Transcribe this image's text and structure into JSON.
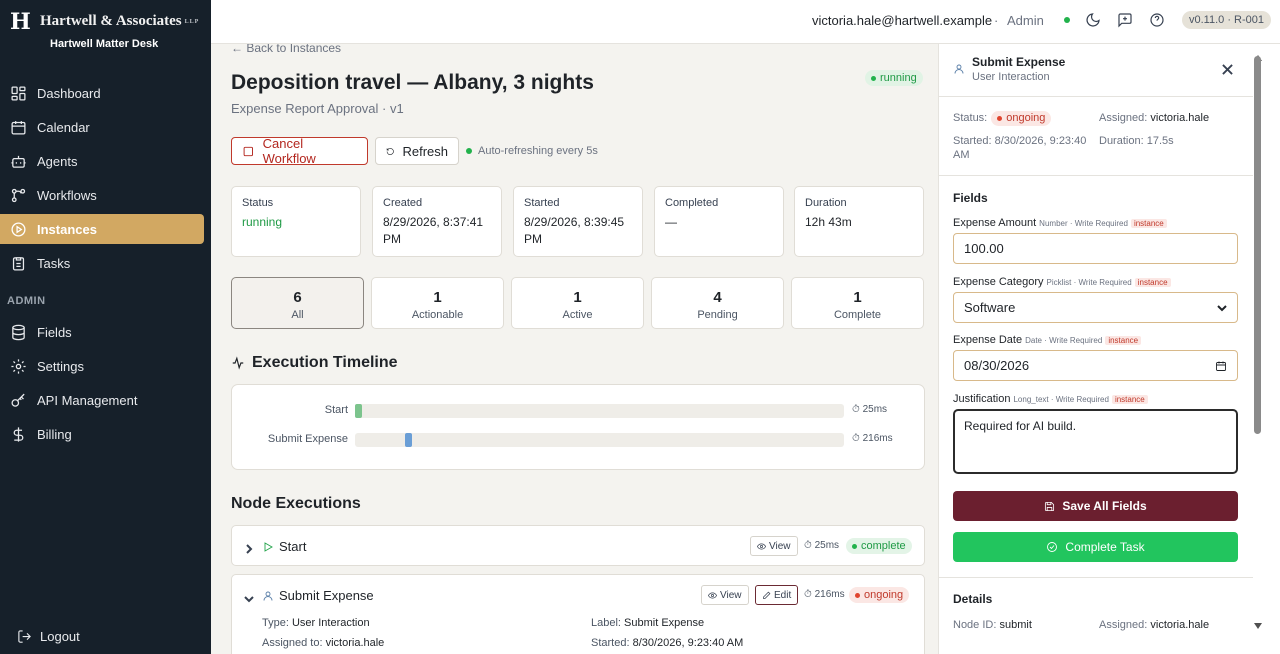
{
  "brand": {
    "logo_letter": "H",
    "firm_name": "Hartwell & Associates",
    "firm_suffix": "LLP",
    "desk_name": "Hartwell Matter Desk"
  },
  "sidebar": {
    "items": [
      {
        "label": "Dashboard",
        "icon": "dashboard-icon"
      },
      {
        "label": "Calendar",
        "icon": "calendar-icon"
      },
      {
        "label": "Agents",
        "icon": "bot-icon"
      },
      {
        "label": "Workflows",
        "icon": "workflow-icon"
      },
      {
        "label": "Instances",
        "icon": "play-icon",
        "active": true
      },
      {
        "label": "Tasks",
        "icon": "clipboard-icon"
      }
    ],
    "admin_heading": "ADMIN",
    "admin_items": [
      {
        "label": "Fields",
        "icon": "database-icon"
      },
      {
        "label": "Settings",
        "icon": "gear-icon"
      },
      {
        "label": "API Management",
        "icon": "key-icon"
      },
      {
        "label": "Billing",
        "icon": "dollar-icon"
      }
    ],
    "logout_label": "Logout"
  },
  "topbar": {
    "user_email": "victoria.hale@hartwell.example",
    "separator": "·",
    "role": "Admin",
    "version": "v0.11.0 · R-001"
  },
  "main": {
    "back_label": "← Back to Instances",
    "title": "Deposition travel — Albany, 3 nights",
    "subtitle": "Expense Report Approval · v1",
    "status_badge": "running",
    "cancel_label": "Cancel Workflow",
    "refresh_label": "Refresh",
    "auto_refresh": "Auto-refreshing every 5s",
    "stats": [
      {
        "label": "Status",
        "value": "running"
      },
      {
        "label": "Created",
        "value": "8/29/2026, 8:37:41 PM"
      },
      {
        "label": "Started",
        "value": "8/29/2026, 8:39:45 PM"
      },
      {
        "label": "Completed",
        "value": "—"
      },
      {
        "label": "Duration",
        "value": "12h 43m"
      }
    ],
    "counts": [
      {
        "num": "6",
        "label": "All"
      },
      {
        "num": "1",
        "label": "Actionable"
      },
      {
        "num": "1",
        "label": "Active"
      },
      {
        "num": "4",
        "label": "Pending"
      },
      {
        "num": "1",
        "label": "Complete"
      }
    ],
    "timeline_heading": "Execution Timeline",
    "timeline": [
      {
        "label": "Start",
        "duration": "25ms",
        "duration_ms": 25,
        "color": "#7cc48d"
      },
      {
        "label": "Submit Expense",
        "duration": "216ms",
        "duration_ms": 216,
        "color": "#6a9ed6"
      }
    ],
    "node_heading": "Node Executions",
    "nodes": [
      {
        "name": "Start",
        "view": "View",
        "duration": "25ms",
        "status": "complete"
      },
      {
        "name": "Submit Expense",
        "view": "View",
        "edit": "Edit",
        "duration": "216ms",
        "status": "ongoing",
        "type_label": "Type:",
        "type_value": "User Interaction",
        "label_label": "Label:",
        "label_value": "Submit Expense",
        "assigned_label": "Assigned to:",
        "assigned_value": "victoria.hale",
        "started_label": "Started:",
        "started_value": "8/30/2026, 9:23:40 AM"
      }
    ]
  },
  "panel": {
    "title": "Submit Expense",
    "subtitle": "User Interaction",
    "status_label": "Status:",
    "status_value": "ongoing",
    "assigned_label": "Assigned:",
    "assigned_value": "victoria.hale",
    "started_label": "Started:",
    "started_value": "8/30/2026, 9:23:40 AM",
    "duration_label": "Duration:",
    "duration_value": "17.5s",
    "fields_heading": "Fields",
    "fields": [
      {
        "label": "Expense Amount",
        "meta": "Number · Write Required",
        "tag": "instance",
        "value": "100.00"
      },
      {
        "label": "Expense Category",
        "meta": "Picklist · Write Required",
        "tag": "instance",
        "value": "Software"
      },
      {
        "label": "Expense Date",
        "meta": "Date · Write Required",
        "tag": "instance",
        "value": "08/30/2026"
      },
      {
        "label": "Justification",
        "meta": "Long_text · Write Required",
        "tag": "instance",
        "value": "Required for AI build."
      }
    ],
    "save_label": "Save All Fields",
    "complete_label": "Complete Task",
    "details_heading": "Details",
    "node_id_label": "Node ID:",
    "node_id_value": "submit",
    "details_assigned_label": "Assigned:",
    "details_assigned_value": "victoria.hale"
  }
}
